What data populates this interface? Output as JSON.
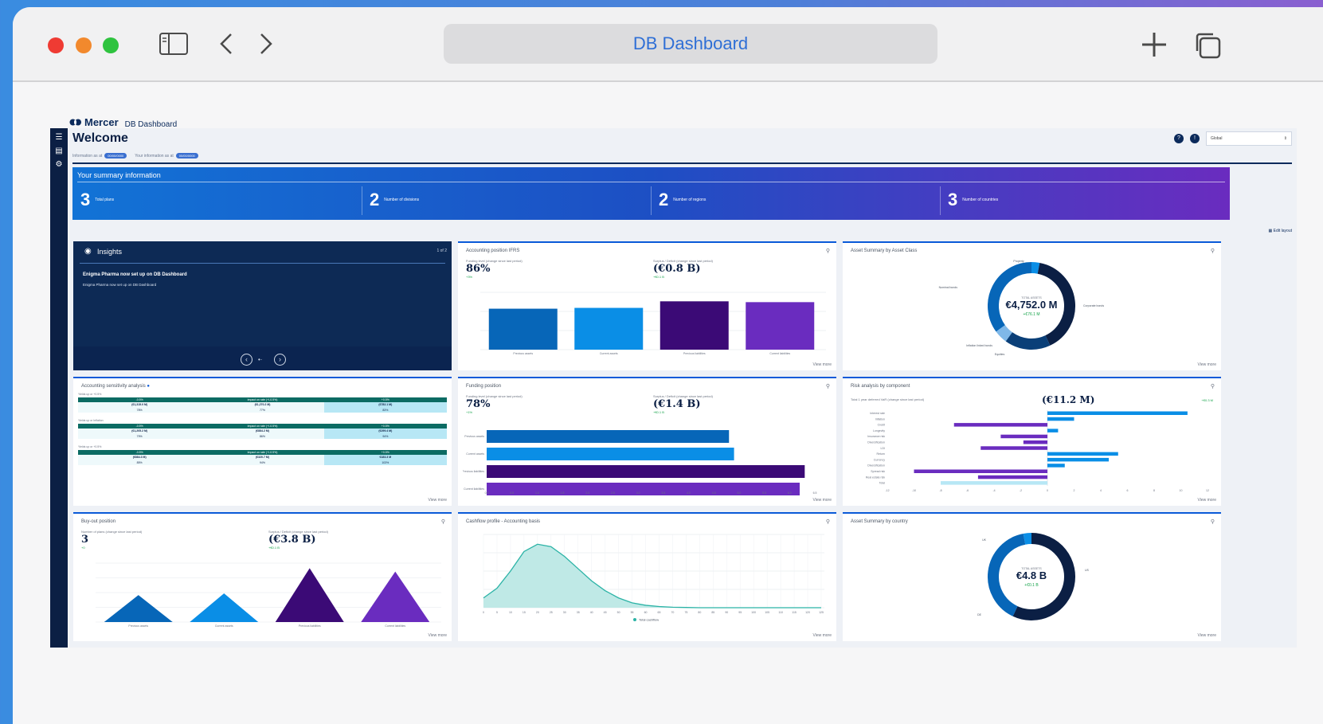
{
  "browser": {
    "title": "DB Dashboard"
  },
  "app": {
    "brand": "Mercer",
    "brand_sub": "DB Dashboard",
    "welcome": "Welcome",
    "info_as_at": "Information as at",
    "your_info_as_at": "Your information as at",
    "info_pill": "00/00/0000",
    "your_info_pill": "00/00/0000",
    "region_select": "Global",
    "edit_layout": "Edit layout"
  },
  "summary": {
    "title": "Your summary information",
    "stats": [
      {
        "value": "3",
        "label": "Total plans"
      },
      {
        "value": "2",
        "label": "Number of divisions"
      },
      {
        "value": "2",
        "label": "Number of regions"
      },
      {
        "value": "3",
        "label": "Number of countries"
      }
    ]
  },
  "insights": {
    "title": "Insights",
    "count": "1 of 2",
    "headline": "Enigma Pharma now set up on DB Dashboard",
    "body": "Enigma Pharma now set up on DB Dashboard"
  },
  "accounting": {
    "title": "Accounting position IFRS",
    "left_caption": "Funding level (change since last period)",
    "left_value": "86%",
    "left_delta": "+3%",
    "right_caption": "Surplus / Deficit (change since last period)",
    "right_value": "(€0.8 B)",
    "right_delta": "+€0.1 B",
    "more": "View more"
  },
  "asset_class": {
    "title": "Asset Summary by Asset Class",
    "total_label": "TOTAL ASSETS",
    "total": "€4,752.0 M",
    "delta": "+€76.1 M",
    "labels": [
      "Property",
      "Nominal bonds",
      "Corporate bonds",
      "Inflation linked bonds",
      "Equities"
    ],
    "more": "View more"
  },
  "sensitivity": {
    "title": "Accounting sensitivity analysis",
    "blocks": [
      {
        "label": "Yields up or +0.5%",
        "heads": [
          "-0.5%",
          "Impact on rate (+/-0.5%)",
          "+0.5%"
        ],
        "values": [
          "(€1,315.0 M)",
          "(€1,270.2 M)",
          "(€782.1 M)"
        ],
        "pcts": [
          "78%",
          "77%",
          "83%"
        ]
      },
      {
        "label": "Yields up or Inflation",
        "heads": [
          "-0.5%",
          "Impact on rate (+/-0.5%)",
          "+0.5%"
        ],
        "values": [
          "(€1,205.2 M)",
          "(€884.2 M)",
          "(€299.4 M)"
        ],
        "pcts": [
          "79%",
          "86%",
          "94%"
        ]
      },
      {
        "label": "Yields up or +0.5%",
        "heads": [
          "-0.5%",
          "Impact on rate (+/-0.5%)",
          "+0.5%"
        ],
        "values": [
          "(€884.3 M)",
          "(€320.7 M)",
          "€183.3 M"
        ],
        "pcts": [
          "85%",
          "94%",
          "103%"
        ]
      }
    ],
    "more": "View more"
  },
  "funding": {
    "title": "Funding position",
    "left_caption": "Funding level (change since last period)",
    "left_value": "78%",
    "left_delta": "+1%",
    "right_caption": "Surplus / Deficit (change since last period)",
    "right_value": "(€1.4 B)",
    "right_delta": "+€0.1 B",
    "more": "View more"
  },
  "risk": {
    "title": "Risk analysis by component",
    "caption": "Total 1 year deferred VaR (change since last period)",
    "value": "(€11.2 M)",
    "delta": "+€0.3 M",
    "more": "View more"
  },
  "buyout": {
    "title": "Buy-out position",
    "left_caption": "Number of plans (change since last period)",
    "left_value": "3",
    "left_delta": "+0",
    "right_caption": "Surplus / Deficit (change since last period)",
    "right_value": "(€3.8 B)",
    "right_delta": "+€0.1 B",
    "more": "View more"
  },
  "cashflow": {
    "title": "Cashflow profile - Accounting basis",
    "legend": "Total cashflow",
    "more": "View more"
  },
  "country": {
    "title": "Asset Summary by country",
    "total_label": "TOTAL ASSETS",
    "total": "€4.8 B",
    "delta": "+€0.1 B",
    "labels": [
      "UK",
      "US",
      "DE"
    ],
    "more": "View more"
  },
  "colors": {
    "brand_navy": "#0b1f44",
    "accent_blue": "#0a5ad8",
    "purple": "#6a2cbf",
    "teal": "#0b6b63",
    "green_delta": "#16a34a"
  },
  "chart_data": [
    {
      "type": "bar",
      "title": "Accounting position IFRS",
      "categories": [
        "Previous assets",
        "Current assets",
        "Previous liabilities",
        "Current liabilities"
      ],
      "values": [
        5.0,
        5.1,
        5.9,
        5.8
      ],
      "ylim": [
        0,
        7
      ]
    },
    {
      "type": "bar",
      "title": "Funding position",
      "orientation": "horizontal",
      "categories": [
        "Previous assets",
        "Current assets",
        "Previous liabilities",
        "Current liabilities"
      ],
      "values": [
        4.8,
        4.9,
        6.3,
        6.2
      ],
      "xlim": [
        0,
        6.5
      ]
    },
    {
      "type": "bar",
      "title": "Risk analysis by component",
      "orientation": "horizontal",
      "categories": [
        "Interest rate",
        "Inflation",
        "Credit",
        "Longevity",
        "Insurance risk",
        "Diversification",
        "LDI",
        "Return",
        "Currency",
        "Diversification",
        "Spread risk",
        "Real estate risk",
        "Total"
      ],
      "values": [
        10.5,
        2.0,
        -7.0,
        0.8,
        -3.5,
        -1.8,
        -5.0,
        5.3,
        4.6,
        1.3,
        -10.0,
        -5.2,
        -8.0
      ],
      "xlim": [
        -12,
        12
      ]
    },
    {
      "type": "area",
      "title": "Cashflow profile - Accounting basis",
      "x": [
        0,
        5,
        10,
        15,
        20,
        25,
        30,
        35,
        40,
        45,
        50,
        55,
        60,
        65,
        70,
        75,
        80,
        85,
        90,
        95,
        100,
        105,
        110,
        115,
        120,
        125
      ],
      "series": [
        {
          "name": "Total cashflow",
          "values": [
            40,
            80,
            150,
            230,
            260,
            250,
            210,
            160,
            110,
            70,
            40,
            20,
            10,
            5,
            2,
            1,
            0,
            0,
            0,
            0,
            0,
            0,
            0,
            0,
            0,
            0
          ]
        }
      ]
    },
    {
      "type": "bar",
      "title": "Buy-out position",
      "categories": [
        "Previous assets",
        "Current assets",
        "Previous liabilities",
        "Current liabilities"
      ],
      "values": [
        1.6,
        1.7,
        3.2,
        3.0
      ],
      "ylim": [
        0,
        3.5
      ]
    },
    {
      "type": "pie",
      "title": "Asset Summary by Asset Class",
      "labels": [
        "Property",
        "Corporate bonds",
        "Equities",
        "Inflation linked bonds",
        "Nominal bonds"
      ],
      "values": [
        3,
        40,
        17,
        5,
        35
      ]
    },
    {
      "type": "pie",
      "title": "Asset Summary by country",
      "labels": [
        "UK",
        "US",
        "DE"
      ],
      "values": [
        57,
        40,
        3
      ]
    }
  ]
}
